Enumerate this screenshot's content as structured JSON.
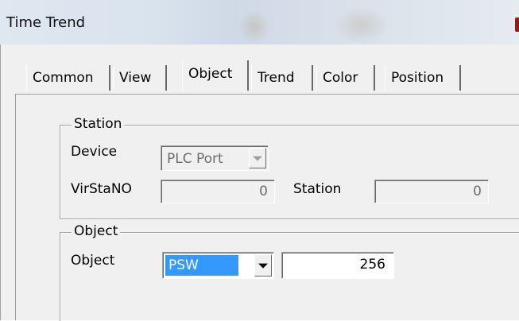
{
  "window": {
    "title": "Time Trend"
  },
  "tabs": [
    {
      "label": "Common"
    },
    {
      "label": "View"
    },
    {
      "label": "Object",
      "active": true
    },
    {
      "label": "Trend"
    },
    {
      "label": "Color"
    },
    {
      "label": "Position"
    }
  ],
  "station_group": {
    "label": "Station",
    "device_label": "Device",
    "device_value": "PLC Port",
    "virstano_label": "VirStaNO",
    "virstano_value": "0",
    "station_label": "Station",
    "station_value": "0"
  },
  "object_group": {
    "label": "Object",
    "object_label": "Object",
    "object_type": "PSW",
    "object_address": "256"
  },
  "colors": {
    "selection": "#3399ff",
    "dialog_bg": "#f0f0f0"
  },
  "icons": {
    "dropdown": "chevron-down-icon"
  }
}
